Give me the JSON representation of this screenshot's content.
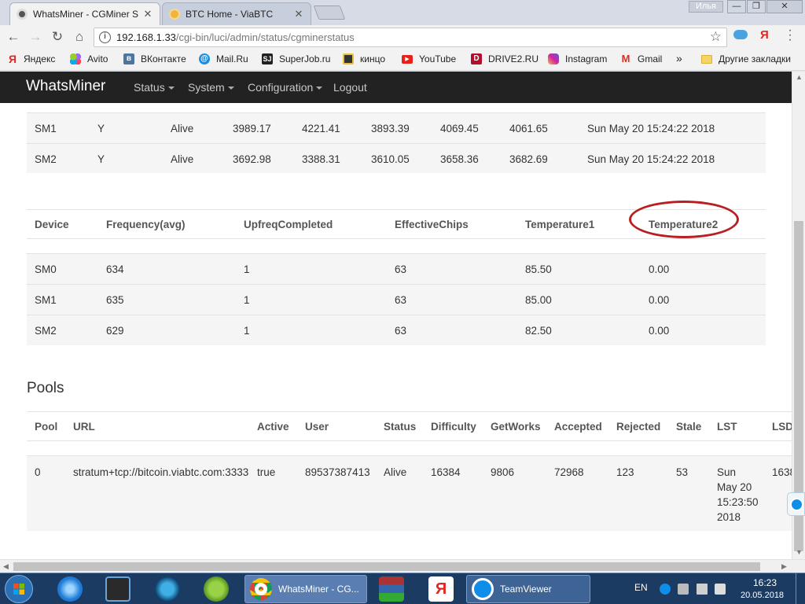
{
  "browser": {
    "tabs": [
      {
        "title": "WhatsMiner - CGMiner S",
        "active": true
      },
      {
        "title": "BTC Home - ViaBTC",
        "active": false
      }
    ],
    "user": "Илья",
    "window_buttons": [
      "—",
      "❐",
      "✕"
    ],
    "address": {
      "host": "192.168.1.33",
      "path": "/cgi-bin/luci/admin/status/cgminerstatus"
    },
    "bookmarks": [
      "Яндекс",
      "Avito",
      "ВКонтакте",
      "Mail.Ru",
      "SuperJob.ru",
      "кинцо",
      "YouTube",
      "DRIVE2.RU",
      "Instagram",
      "Gmail"
    ],
    "bookmarks_more": "»",
    "other_bookmarks": "Другие закладки"
  },
  "app": {
    "brand": "WhatsMiner",
    "nav": [
      "Status",
      "System",
      "Configuration",
      "Logout"
    ]
  },
  "devices_top": {
    "rows": [
      [
        "SM1",
        "Y",
        "Alive",
        "3989.17",
        "4221.41",
        "3893.39",
        "4069.45",
        "4061.65",
        "Sun May 20 15:24:22 2018"
      ],
      [
        "SM2",
        "Y",
        "Alive",
        "3692.98",
        "3388.31",
        "3610.05",
        "3658.36",
        "3682.69",
        "Sun May 20 15:24:22 2018"
      ]
    ]
  },
  "devices": {
    "headers": [
      "Device",
      "Frequency(avg)",
      "UpfreqCompleted",
      "EffectiveChips",
      "Temperature1",
      "Temperature2"
    ],
    "rows": [
      [
        "SM0",
        "634",
        "1",
        "63",
        "85.50",
        "0.00"
      ],
      [
        "SM1",
        "635",
        "1",
        "63",
        "85.00",
        "0.00"
      ],
      [
        "SM2",
        "629",
        "1",
        "63",
        "82.50",
        "0.00"
      ]
    ]
  },
  "pools": {
    "title": "Pools",
    "headers": [
      "Pool",
      "URL",
      "Active",
      "User",
      "Status",
      "Difficulty",
      "GetWorks",
      "Accepted",
      "Rejected",
      "Stale",
      "LST",
      "LSD"
    ],
    "rows": [
      [
        "0",
        "stratum+tcp://bitcoin.viabtc.com:3333",
        "true",
        "89537387413",
        "Alive",
        "16384",
        "9806",
        "72968",
        "123",
        "53",
        [
          "Sun",
          "May 20",
          "15:23:50",
          "2018"
        ],
        "1638"
      ]
    ]
  },
  "taskbar": {
    "chrome_label": "WhatsMiner - CG...",
    "teamviewer_label": "TeamViewer",
    "lang": "EN",
    "time": "16:23",
    "date": "20.05.2018"
  },
  "colors": {
    "nav_bg": "#222222",
    "highlight_circle": "#b81e22",
    "taskbar": "#1c3b63"
  }
}
